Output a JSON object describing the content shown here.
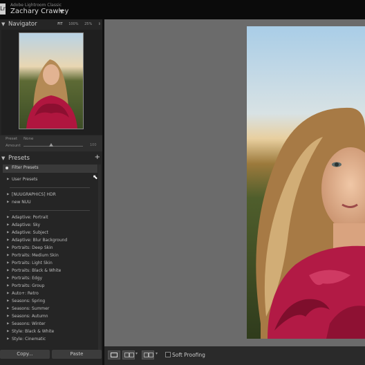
{
  "identity": {
    "app_name": "Adobe Lightroom Classic",
    "user_name": "Zachary Crawley",
    "logo_text": "Lr"
  },
  "navigator": {
    "title": "Navigator",
    "zoom_options": [
      "FIT",
      "100%",
      "25%"
    ]
  },
  "quick_preset": {
    "preset_label": "Preset",
    "preset_value": "None",
    "amount_label": "Amount",
    "amount_value": "100",
    "amount_level": 0.47
  },
  "presets_panel": {
    "title": "Presets",
    "add_symbol": "+",
    "filter_label": "Filter Presets",
    "user_presets": "User Presets",
    "groups": [
      "[NUUGRAPHICS] HDR",
      "new NUU"
    ],
    "items": [
      "Adaptive: Portrait",
      "Adaptive: Sky",
      "Adaptive: Subject",
      "Adaptive: Blur Background",
      "Portraits: Deep Skin",
      "Portraits: Medium Skin",
      "Portraits: Light Skin",
      "Portraits: Black & White",
      "Portraits: Edgy",
      "Portraits: Group",
      "Auto+: Retro",
      "Seasons: Spring",
      "Seasons: Summer",
      "Seasons: Autumn",
      "Seasons: Winter",
      "Style: Black & White",
      "Style: Cinematic"
    ]
  },
  "buttons": {
    "copy": "Copy...",
    "paste": "Paste"
  },
  "toolbar": {
    "soft_proofing": "Soft Proofing"
  },
  "icons": [
    "lightroom-logo-icon",
    "collapse-triangle-icon",
    "add-preset-icon",
    "disclosure-triangle-icon",
    "loupe-view-icon",
    "compare-view-icon",
    "survey-view-icon",
    "mouse-cursor-icon"
  ]
}
